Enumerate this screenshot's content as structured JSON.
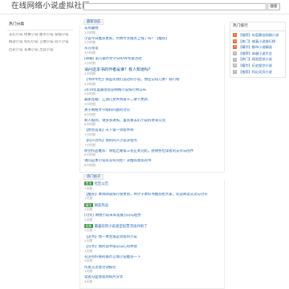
{
  "header": {
    "site_title": "在线网络小说虚拟社区",
    "search_placeholder": "",
    "search_button": "搜索"
  },
  "left": {
    "heading": "热门分类",
    "links": [
      "玄幻小说",
      "修真小说",
      "都市小说",
      "穿越小说",
      "网游小说",
      "科幻小说",
      "言情小说",
      "同人小说",
      "历史小说",
      "军事小说",
      "灵异小说"
    ]
  },
  "main": {
    "section1_label": "最新动态",
    "section1": [
      {
        "tag": "",
        "title": "东风破晓",
        "meta": "2小时前"
      },
      {
        "tag": "",
        "title": "小说今日推荐更新，付费专享服务上线了吗？【推荐】",
        "meta": "2小时前"
      },
      {
        "tag": "",
        "title": "东方夜谈",
        "meta": "3小时前"
      },
      {
        "tag": "",
        "title": "[转载] 南方都市文学SHOW专题活动",
        "meta": "3小时前"
      },
      {
        "tag": "",
        "title": "请问这本书的作者是谁？有人知道吗？",
        "meta": "4小时前",
        "big": true
      },
      {
        "tag": "",
        "title": "【书评专栏】那些年我们追过的小说，你还记得几本？排行榜",
        "meta": "4小时前",
        "wrap": true
      },
      {
        "tag": "",
        "title": "2019年度最受欢迎网络小说排行榜公布",
        "meta": "5小时前"
      },
      {
        "tag": "",
        "title": "最新连载：江湖儿女传奇第十二章节更新",
        "meta": "5小时前"
      },
      {
        "tag": "",
        "title": "关于网络文学版权问题的讨论",
        "meta": "6小时前"
      },
      {
        "tag": "",
        "title": "新人报到，请多多关照，喜欢看玄幻小说的进来交流",
        "meta": "6小时前"
      },
      {
        "tag": "",
        "title": "【原创首发】天下第一剑客传奇",
        "meta": "7小时前"
      },
      {
        "tag": "",
        "title": "【同人创作】我的同人小说求指点",
        "meta": "7小时前"
      },
      {
        "tag": "",
        "title": "原创作品推荐：修仙之路第三卷正式完结，感谢各位读者的支持与陪伴",
        "meta": "8小时前",
        "wrap": true
      },
      {
        "tag": "",
        "title": "请问这本小说有没有完结？求推荐类似的书",
        "meta": "8小时前"
      }
    ],
    "section2_label": "热门帖子",
    "section2": [
      {
        "tag": "置顶",
        "title": "社区公告",
        "meta": "1天前"
      },
      {
        "tag": "",
        "title": "【推荐】本周阅读排行榜更新，共计十本好书推荐给大家，欢迎阅读交流与讨论",
        "meta": "1天前",
        "wrap": true
      },
      {
        "tag": "精华",
        "title": "网友热议",
        "meta": "1天前"
      },
      {
        "tag": "",
        "title": "[讨论] 网络小说未来发展方向与趋势",
        "meta": "2天前"
      },
      {
        "tag": "投票",
        "title": "最喜欢的小说类型投票活动开始了",
        "meta": "2天前"
      },
      {
        "tag": "",
        "title": "【求书】找一本主角是剑客的小说",
        "meta": "2天前"
      },
      {
        "tag": "",
        "title": "【分享】我的读书笔记与心得体会",
        "meta": "3天前"
      },
      {
        "tag": "",
        "title": "有没有好看的都市言情小说推荐一下",
        "meta": "3天前"
      },
      {
        "tag": "",
        "title": "作者交流会活动报名",
        "meta": "3天前"
      },
      {
        "tag": "",
        "title": "读者见面会现场照片分享",
        "meta": "4天前"
      }
    ]
  },
  "right": {
    "heading": "热门排行",
    "items": [
      "【推荐】年度最佳网络小说",
      "【热门】修真小说排行榜",
      "【精华】都市小说精选",
      "【推荐】穿越小说大全",
      "【热门】网游竞技小说",
      "【精华】历史架空小说",
      "【推荐】科幻灵异小说"
    ]
  },
  "colors": {
    "link": "#1e64b4",
    "tag": "#3d9448",
    "rank_hot": "#e86b3c"
  }
}
